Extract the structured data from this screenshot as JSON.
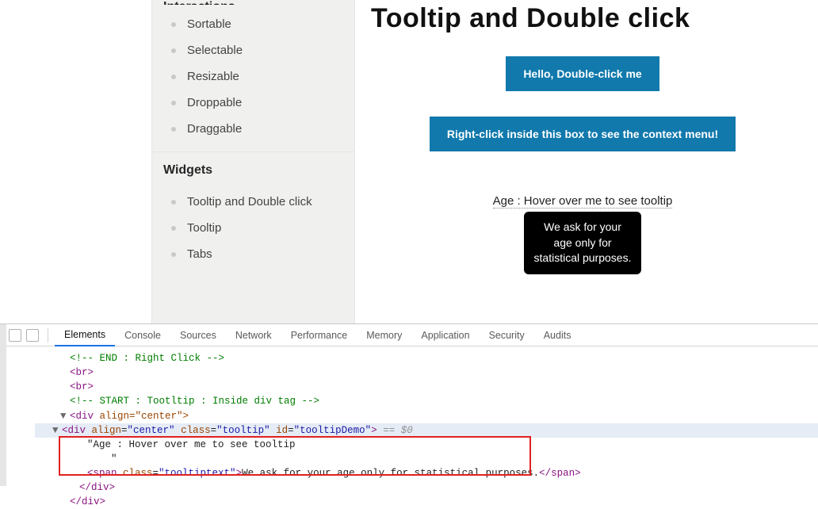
{
  "sidebar": {
    "interactions_header": "Interactions",
    "interactions": [
      "Sortable",
      "Selectable",
      "Resizable",
      "Droppable",
      "Draggable"
    ],
    "widgets_header": "Widgets",
    "widgets": [
      "Tooltip and Double click",
      "Tooltip",
      "Tabs"
    ]
  },
  "content": {
    "title": "Tooltip and Double click",
    "double_click_btn": "Hello, Double-click me",
    "context_btn": "Right-click inside this box to see the context menu!",
    "tooltip_trigger": "Age : Hover over me to see tooltip",
    "tooltip_text": "We ask for your age only for statistical purposes."
  },
  "devtools": {
    "tabs": [
      "Elements",
      "Console",
      "Sources",
      "Network",
      "Performance",
      "Memory",
      "Application",
      "Security",
      "Audits"
    ],
    "code": {
      "l1": "<!-- END : Right Click -->",
      "l2": "<br>",
      "l3": "<br>",
      "l4": "<!-- START : Tootltip : Inside div tag -->",
      "l5_open": "<div",
      "l5_attr": " align=\"center\">",
      "l6_open": "<div",
      "l6_a1n": " align",
      "l6_a1v": "\"center\"",
      "l6_a2n": " class",
      "l6_a2v": "\"tooltip\"",
      "l6_a3n": " id",
      "l6_a3v": "\"tooltipDemo\"",
      "l6_close": ">",
      "l6_sel": " == $0",
      "l7": "\"Age : Hover over me to see tooltip",
      "l8": "    \"",
      "l9_open": "<span",
      "l9_an": " class",
      "l9_av": "\"tooltiptext\"",
      "l9_close": ">",
      "l9_text": "We ask for your age only for statistical purposes.",
      "l9_end": "</span>",
      "l10": "</div>",
      "l11": "</div>"
    }
  }
}
